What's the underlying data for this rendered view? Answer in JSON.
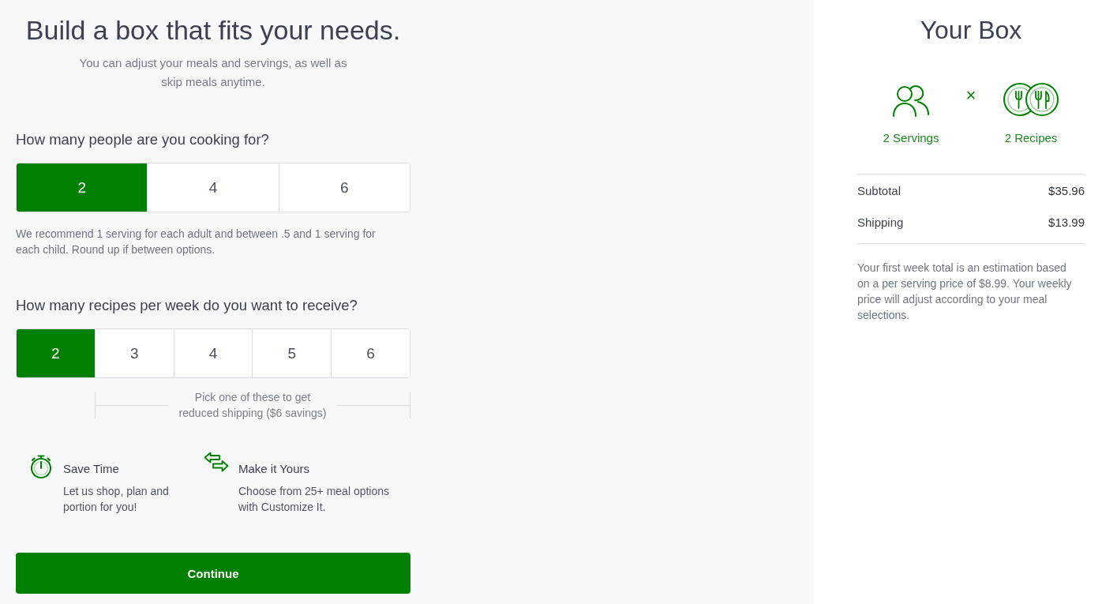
{
  "heading": {
    "title": "Build a box that fits your needs.",
    "subtitle": "You can adjust your meals and servings, as well as skip meals anytime."
  },
  "questions": [
    {
      "prompt": "How many people are you cooking for?",
      "options": [
        {
          "label": "2",
          "selected": true
        },
        {
          "label": "4",
          "selected": false
        },
        {
          "label": "6",
          "selected": false
        }
      ],
      "note": "We recommend 1 serving for each adult and between .5 and 1 serving for each child. Round up if between options."
    },
    {
      "prompt": "How many recipes per week do you want to receive?",
      "options": [
        {
          "label": "2",
          "selected": true
        },
        {
          "label": "3",
          "selected": false
        },
        {
          "label": "4",
          "selected": false
        },
        {
          "label": "5",
          "selected": false
        },
        {
          "label": "6",
          "selected": false
        }
      ],
      "bracket_note": "Pick one of these to get reduced shipping ($6 savings)"
    }
  ],
  "features": [
    {
      "kind": "stopwatch",
      "title": "Save Time",
      "text": "Let us shop, plan and portion for you!"
    },
    {
      "kind": "swap",
      "title": "Make it Yours",
      "text": "Choose from 25+ meal options with Customize It."
    }
  ],
  "continue_button": "Continue",
  "summary": {
    "title": "Your Box",
    "items": [
      {
        "kind": "servings",
        "label": "2 Servings"
      },
      {
        "kind": "recipes",
        "label": "2 Recipes"
      }
    ],
    "separator": "×",
    "lines": [
      {
        "label": "Subtotal",
        "amount": "$35.96"
      },
      {
        "label": "Shipping",
        "amount": "$13.99"
      }
    ],
    "note": "Your first week total is an estimation based on a per serving price of $8.99. Your weekly price will adjust according to your meal selections."
  }
}
